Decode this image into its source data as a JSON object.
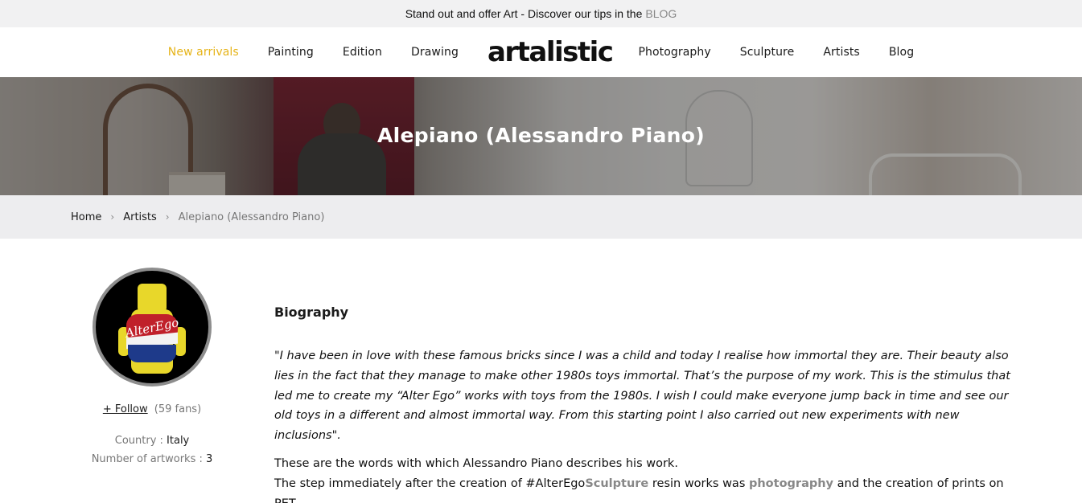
{
  "topbar": {
    "text": "Stand out and offer Art - Discover our tips in the",
    "link": "BLOG"
  },
  "nav": {
    "left": [
      "New arrivals",
      "Painting",
      "Edition",
      "Drawing"
    ],
    "logo": "artalistic",
    "right": [
      "Photography",
      "Sculpture",
      "Artists",
      "Blog"
    ]
  },
  "hero": {
    "title": "Alepiano (Alessandro Piano)"
  },
  "breadcrumb": {
    "home": "Home",
    "artists": "Artists",
    "current": "Alepiano (Alessandro Piano)"
  },
  "profile": {
    "avatar_text": "AlterEgo",
    "follow_label": "+ Follow",
    "fans": "(59 fans)",
    "country_label": "Country : ",
    "country_value": "Italy",
    "artworks_label": "Number of artworks : ",
    "artworks_value": "3"
  },
  "bio": {
    "heading": "Biography",
    "quote": "\"I have been in love with these famous bricks since I was a child and today I realise how immortal they are. Their beauty also lies in the fact that they manage to make other 1980s toys immortal. That’s the purpose of my work. This is the stimulus that led me to create my “Alter Ego” works with toys from the 1980s. I wish I could make everyone jump back in time and see our old toys in a different and almost immortal way. From this starting point I also carried out new experiments with new inclusions\".",
    "line1": "These are the words with which Alessandro Piano describes his work.",
    "line2_a": "The step immediately after the creation of #AlterEgo",
    "line2_link1": "Sculpture",
    "line2_b": " resin works was ",
    "line2_link2": "photography",
    "line2_c": " and the creation of prints on PET."
  },
  "colors": {
    "accent": "#e6b41a",
    "muted_link": "#888888"
  }
}
